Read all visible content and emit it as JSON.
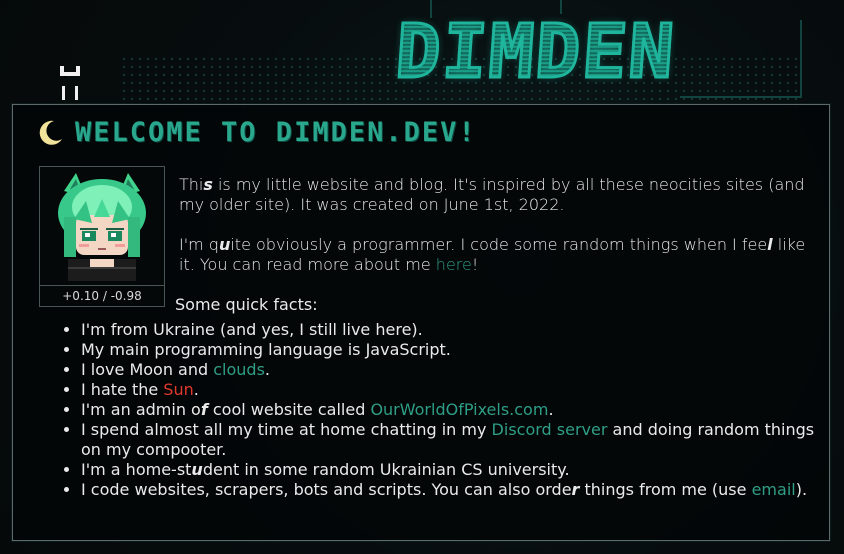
{
  "site": {
    "logo_text": "DIMDEN",
    "title": "WELCOME TO DIMDEN.DEV!"
  },
  "profile": {
    "rating": "+0.10 / -0.98"
  },
  "intro": {
    "p1_part1": "Thi",
    "p1_em": "s",
    "p1_part2": " is my little website and blog. It's inspired by all these neocities sites (and my older site). It was created on June 1st, 2022.",
    "p2_part1": "I'm q",
    "p2_em1": "u",
    "p2_part2": "ite obviously a programmer. I code some random things when I fee",
    "p2_em2": "l",
    "p2_part3": " like it. You can read more about me ",
    "p2_link": "here",
    "p2_part4": "!"
  },
  "facts_heading": "Some quick facts:",
  "facts": {
    "f1": "I'm from Ukraine (and yes, I still live here).",
    "f2": "My main programming language is JavaScript.",
    "f3_part1": "I love Moon and ",
    "f3_link": "clouds",
    "f3_part2": ".",
    "f4_part1": "I hate the ",
    "f4_link": "Sun",
    "f4_part2": ".",
    "f5_part1": "I'm an admin o",
    "f5_em": "f",
    "f5_part2": " cool website called ",
    "f5_link": "OurWorldOfPixels.com",
    "f5_part3": ".",
    "f6_part1": "I spend almost all my time at home chatting in my ",
    "f6_link": "Discord server",
    "f6_part2": " and doing random things on my compooter.",
    "f7_part1": "I'm a home-st",
    "f7_em": "u",
    "f7_part2": "dent in some random Ukrainian CS university.",
    "f8_part1": "I code websites, scrapers, bots and scripts. You can also orde",
    "f8_em": "r",
    "f8_part2": " things from me (use ",
    "f8_link": "email",
    "f8_part3": ")."
  },
  "colors": {
    "accent": "#2aa88e",
    "link": "#2e9e86",
    "sun": "#e0392b",
    "moon": "#f2e39a"
  },
  "icons": {
    "moon": "crescent-moon-icon",
    "cat": "pixel-cat-icon"
  }
}
